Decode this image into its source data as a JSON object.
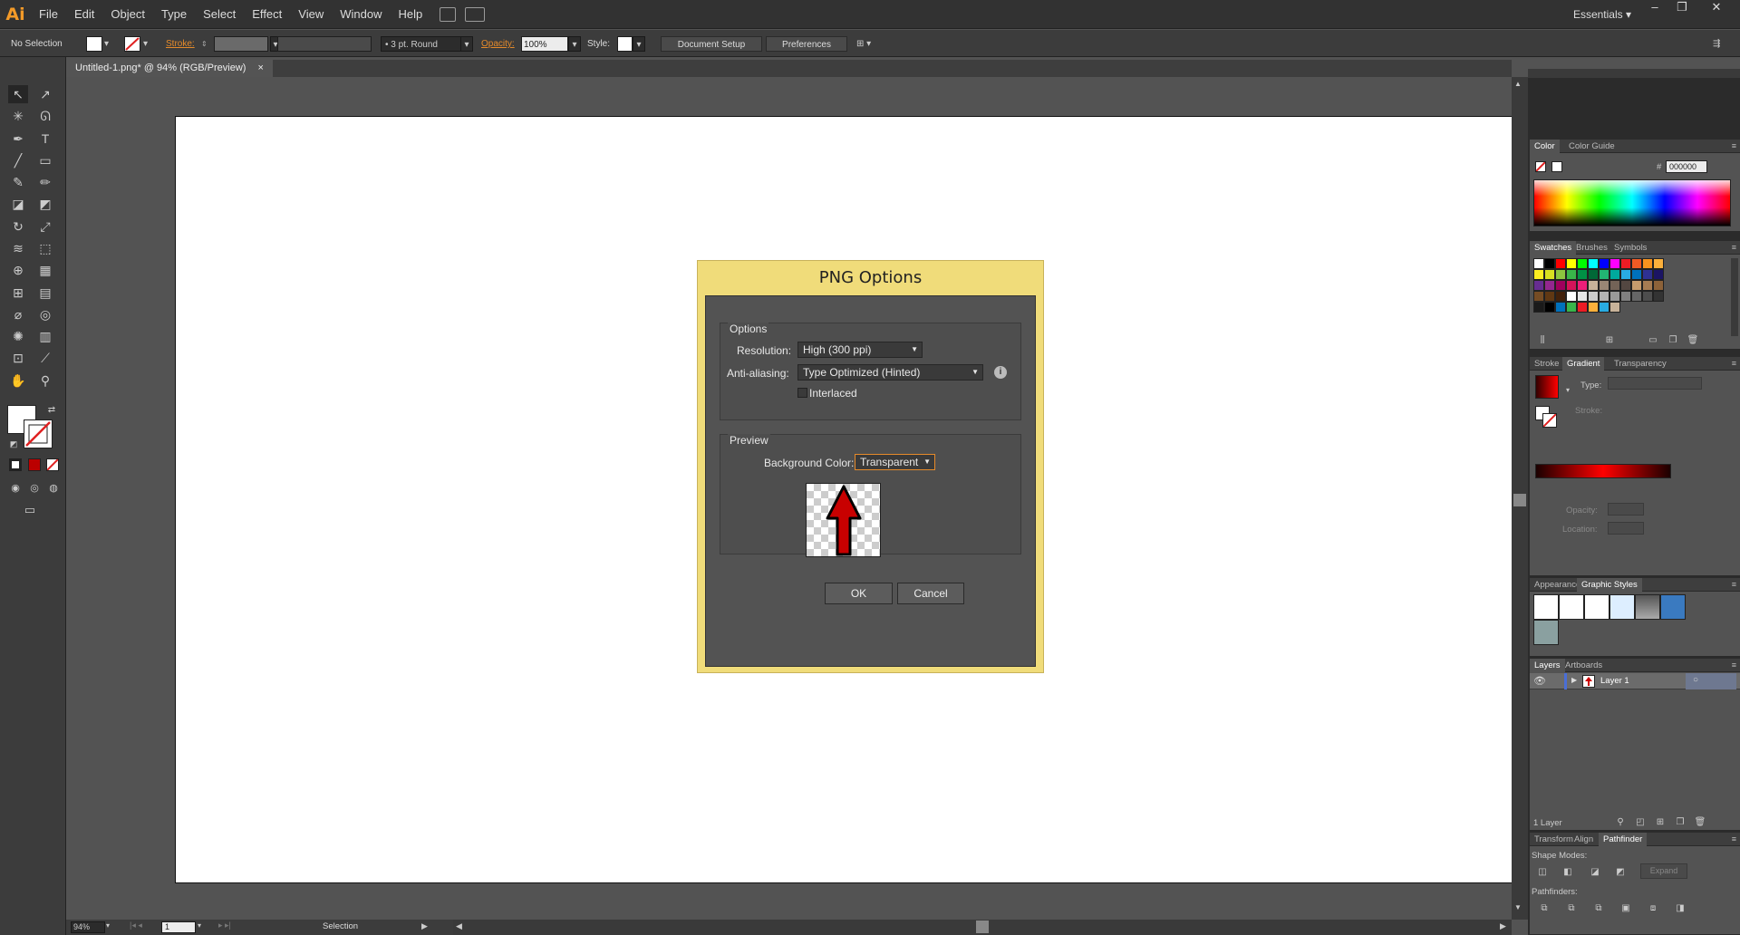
{
  "app": {
    "logo": "Ai"
  },
  "menu": [
    "File",
    "Edit",
    "Object",
    "Type",
    "Select",
    "Effect",
    "View",
    "Window",
    "Help"
  ],
  "workspace": "Essentials",
  "window_controls": [
    "–",
    "❐",
    "✕"
  ],
  "control_bar": {
    "selection": "No Selection",
    "stroke_label": "Stroke:",
    "brush": "3 pt. Round",
    "opacity_label": "Opacity:",
    "opacity_value": "100%",
    "style_label": "Style:",
    "document_setup": "Document Setup",
    "preferences": "Preferences"
  },
  "document_tab": {
    "title": "Untitled-1.png* @ 94% (RGB/Preview)",
    "close": "×"
  },
  "statusbar": {
    "zoom": "94%",
    "artboard": "1",
    "tool_status": "Selection"
  },
  "dialog": {
    "title": "PNG Options",
    "options_group": "Options",
    "resolution_label": "Resolution:",
    "resolution_value": "High (300 ppi)",
    "antialias_label": "Anti-aliasing:",
    "antialias_value": "Type Optimized (Hinted)",
    "interlaced_label": "Interlaced",
    "interlaced_checked": false,
    "preview_group": "Preview",
    "bg_label": "Background Color:",
    "bg_value": "Transparent",
    "ok": "OK",
    "cancel": "Cancel"
  },
  "panels": {
    "color": {
      "tabs": [
        "Color",
        "Color Guide"
      ],
      "hex_label": "#",
      "hex_value": "000000"
    },
    "swatches": {
      "tabs": [
        "Swatches",
        "Brushes",
        "Symbols"
      ],
      "colors": [
        [
          "#ffffff",
          "#000000",
          "#ff0000",
          "#ffff00",
          "#00ff00",
          "#00ffff",
          "#0000ff",
          "#ff00ff",
          "#ed1c24",
          "#f15a24",
          "#f7931e",
          "#fbb03b"
        ],
        [
          "#fcee21",
          "#d9e021",
          "#8cc63f",
          "#39b54a",
          "#009245",
          "#006837",
          "#22b573",
          "#00a99d",
          "#29abe2",
          "#0071bc",
          "#2e3192",
          "#1b1464"
        ],
        [
          "#662d91",
          "#93278f",
          "#9e005d",
          "#d4145a",
          "#ed1e79",
          "#c7b299",
          "#998675",
          "#736357",
          "#534741",
          "#c69c6d",
          "#a67c52",
          "#8c6239"
        ],
        [
          "#754c24",
          "#603813",
          "#42210b",
          "#ffffff",
          "#e6e6e6",
          "#cccccc",
          "#b3b3b3",
          "#999999",
          "#808080",
          "#666666",
          "#4d4d4d",
          "#333333"
        ],
        [
          "#1a1a1a",
          "#000000",
          "#0071bc",
          "#39b54a",
          "#ed1c24",
          "#fbb03b",
          "#29abe2",
          "#c7b299"
        ]
      ]
    },
    "stroke_gradient": {
      "tabs": [
        "Stroke",
        "Gradient",
        "Transparency"
      ],
      "type_label": "Type:",
      "stroke_label": "Stroke:",
      "opacity_label": "Opacity:",
      "location_label": "Location:"
    },
    "appearance": {
      "tabs": [
        "Appearance",
        "Graphic Styles"
      ]
    },
    "layers": {
      "tabs": [
        "Layers",
        "Artboards"
      ],
      "layer_name": "Layer 1",
      "count": "1 Layer"
    },
    "pathfinder": {
      "tabs": [
        "Transform",
        "Align",
        "Pathfinder"
      ],
      "shape_modes": "Shape Modes:",
      "expand": "Expand",
      "pathfinders": "Pathfinders:"
    }
  }
}
